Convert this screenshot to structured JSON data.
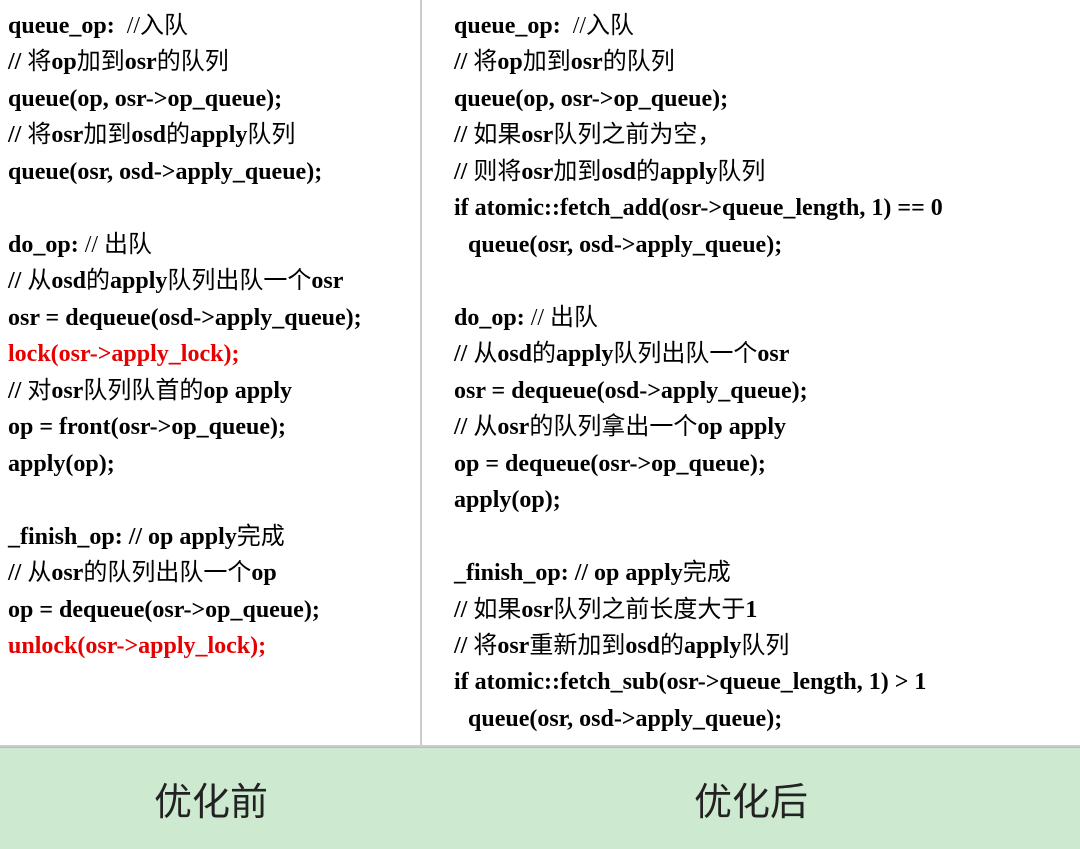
{
  "left": {
    "lines": [
      {
        "pre": "queue_op:  ",
        "cn": "//入队"
      },
      {
        "pre": "// ",
        "cn": "将",
        "b1": "op",
        "cn2": "加到",
        "b2": "osr",
        "cn3": "的队列"
      },
      {
        "t": "queue(op, osr->op_queue);"
      },
      {
        "pre": "// ",
        "cn": "将",
        "b1": "osr",
        "cn2": "加到",
        "b2": "osd",
        "cn3": "的",
        "b3": "apply",
        "cn4": "队列"
      },
      {
        "t": "queue(osr, osd->apply_queue);"
      },
      {
        "blank": true
      },
      {
        "pre": "do_op: ",
        "cn": "// 出队"
      },
      {
        "pre": "// ",
        "cn": "从",
        "b1": "osd",
        "cn2": "的",
        "b2": "apply",
        "cn3": "队列出队一个",
        "b3": "osr"
      },
      {
        "t": "osr = dequeue(osd->apply_queue);"
      },
      {
        "t": "lock(osr->apply_lock);",
        "red": true
      },
      {
        "pre": "// ",
        "cn": "对",
        "b1": "osr",
        "cn2": "队列队首的",
        "b2": "op apply"
      },
      {
        "t": "op = front(osr->op_queue);"
      },
      {
        "t": "apply(op);"
      },
      {
        "blank": true
      },
      {
        "pre": "_finish_op: // op apply",
        "cn": "完成"
      },
      {
        "pre": "// ",
        "cn": "从",
        "b1": "osr",
        "cn2": "的队列出队一个",
        "b2": "op"
      },
      {
        "t": "op = dequeue(osr->op_queue);"
      },
      {
        "t": "unlock(osr->apply_lock);",
        "red": true
      }
    ]
  },
  "right": {
    "lines": [
      {
        "pre": "queue_op:  ",
        "cn": "//入队"
      },
      {
        "pre": "// ",
        "cn": "将",
        "b1": "op",
        "cn2": "加到",
        "b2": "osr",
        "cn3": "的队列"
      },
      {
        "t": "queue(op, osr->op_queue);"
      },
      {
        "pre": "// ",
        "cn": "如果",
        "b1": "osr",
        "cn2": "队列之前为空，"
      },
      {
        "pre": "// ",
        "cn": "则将",
        "b1": "osr",
        "cn2": "加到",
        "b2": "osd",
        "cn3": "的",
        "b3": "apply",
        "cn4": "队列"
      },
      {
        "t": "if atomic::fetch_add(osr->queue_length, 1) == 0"
      },
      {
        "t": "queue(osr, osd->apply_queue);",
        "indent": true
      },
      {
        "blank": true
      },
      {
        "pre": "do_op: ",
        "cn": "// 出队"
      },
      {
        "pre": "// ",
        "cn": "从",
        "b1": "osd",
        "cn2": "的",
        "b2": "apply",
        "cn3": "队列出队一个",
        "b3": "osr"
      },
      {
        "t": "osr = dequeue(osd->apply_queue);"
      },
      {
        "pre": "// ",
        "cn": "从",
        "b1": "osr",
        "cn2": "的队列拿出一个",
        "b2": "op apply"
      },
      {
        "t": "op = dequeue(osr->op_queue);"
      },
      {
        "t": "apply(op);"
      },
      {
        "blank": true
      },
      {
        "pre": "_finish_op: // op apply",
        "cn": "完成"
      },
      {
        "pre": "// ",
        "cn": "如果",
        "b1": "osr",
        "cn2": "队列之前长度大于",
        "b2": "1"
      },
      {
        "pre": "// ",
        "cn": "将",
        "b1": "osr",
        "cn2": "重新加到",
        "b2": "osd",
        "cn3": "的",
        "b3": "apply",
        "cn4": "队列"
      },
      {
        "t": "if atomic::fetch_sub(osr->queue_length, 1) > 1"
      },
      {
        "t": "queue(osr, osd->apply_queue);",
        "indent": true
      }
    ]
  },
  "labels": {
    "before": "优化前",
    "after": "优化后"
  }
}
